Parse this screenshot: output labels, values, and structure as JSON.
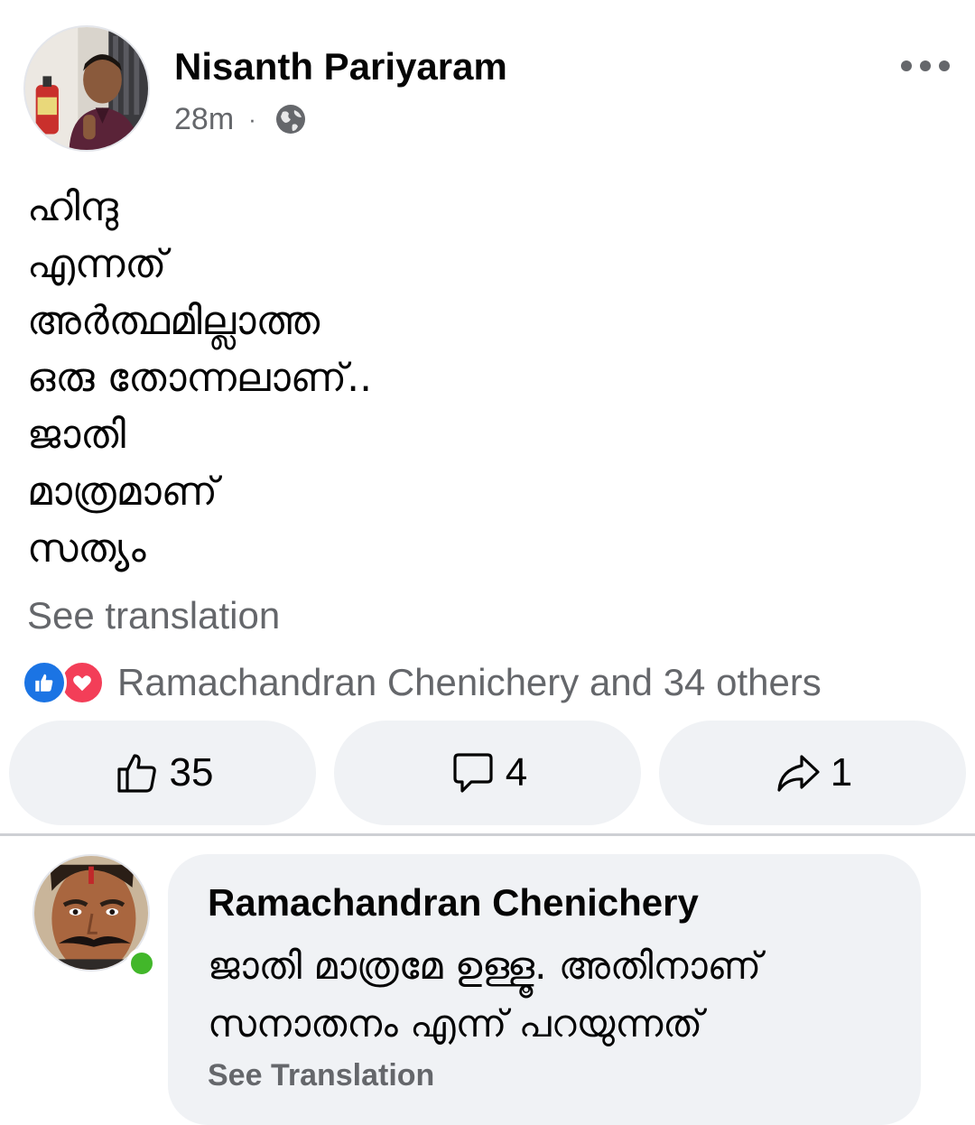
{
  "post": {
    "author_name": "Nisanth Pariyaram",
    "timestamp": "28m",
    "meta_separator": "·",
    "privacy_icon": "globe-icon",
    "more_icon": "more-options-icon",
    "text_lines": [
      "ഹിന്ദു",
      "എന്നത്",
      "അർത്ഥമില്ലാത്ത",
      "ഒരു തോന്നലാണ്..",
      "ജാതി",
      "മാത്രമാണ്",
      "സത്യം"
    ],
    "see_translation": "See translation"
  },
  "reactions": {
    "icons": [
      "like-reaction-icon",
      "love-reaction-icon"
    ],
    "summary": "Ramachandran Chenichery and 34 others",
    "colors": {
      "like": "#1b74e4",
      "love": "#f33e58"
    }
  },
  "actions": {
    "like": {
      "icon": "thumbs-up-icon",
      "count": "35"
    },
    "comment": {
      "icon": "comment-icon",
      "count": "4"
    },
    "share": {
      "icon": "share-icon",
      "count": "1"
    }
  },
  "comment": {
    "author_name": "Ramachandran Chenichery",
    "online": true,
    "online_color": "#42b72a",
    "text_lines": [
      "ജാതി മാത്രമേ ഉള്ളൂ. അതിനാണ്",
      "സനാതനം എന്ന് പറയുന്നത്"
    ],
    "see_translation": "See Translation"
  }
}
